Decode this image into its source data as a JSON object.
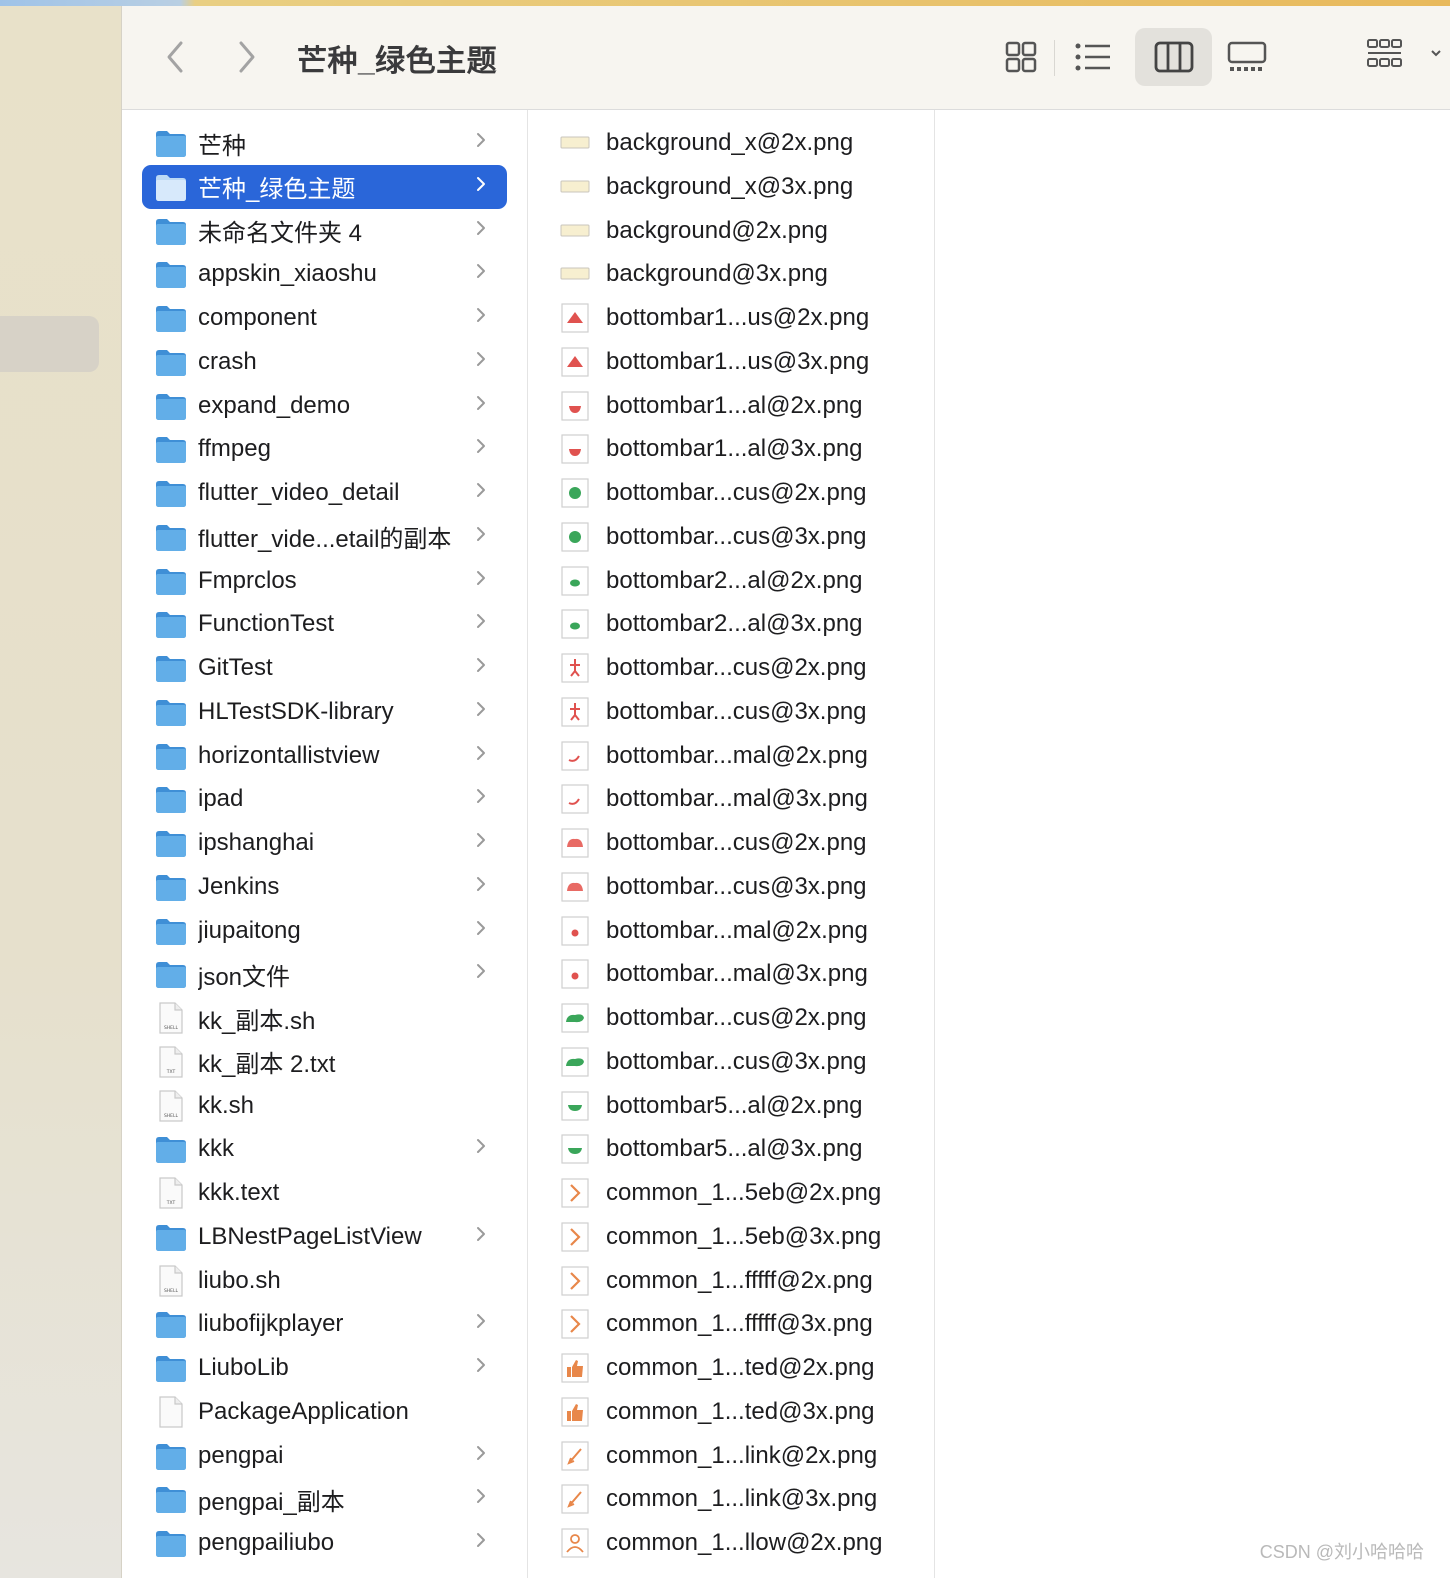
{
  "window": {
    "title": "芒种_绿色主题"
  },
  "toolbar": {
    "back_icon": "chevron-left-icon",
    "forward_icon": "chevron-right-icon",
    "views": [
      "icon-view",
      "list-view",
      "column-view",
      "gallery-view",
      "group-by"
    ]
  },
  "folder_column": [
    {
      "label": "芒种",
      "kind": "folder"
    },
    {
      "label": "芒种_绿色主题",
      "kind": "folder",
      "selected": true
    },
    {
      "label": "未命名文件夹 4",
      "kind": "folder"
    },
    {
      "label": "appskin_xiaoshu",
      "kind": "folder"
    },
    {
      "label": "component",
      "kind": "folder"
    },
    {
      "label": "crash",
      "kind": "folder"
    },
    {
      "label": "expand_demo",
      "kind": "folder"
    },
    {
      "label": "ffmpeg",
      "kind": "folder"
    },
    {
      "label": "flutter_video_detail",
      "kind": "folder"
    },
    {
      "label": "flutter_vide...etail的副本",
      "kind": "folder"
    },
    {
      "label": "Fmprclos",
      "kind": "folder"
    },
    {
      "label": "FunctionTest",
      "kind": "folder"
    },
    {
      "label": "GitTest",
      "kind": "folder"
    },
    {
      "label": "HLTestSDK-library",
      "kind": "folder"
    },
    {
      "label": "horizontallistview",
      "kind": "folder"
    },
    {
      "label": "ipad",
      "kind": "folder"
    },
    {
      "label": "ipshanghai",
      "kind": "folder"
    },
    {
      "label": "Jenkins",
      "kind": "folder"
    },
    {
      "label": "jiupaitong",
      "kind": "folder"
    },
    {
      "label": "json文件",
      "kind": "folder"
    },
    {
      "label": "kk_副本.sh",
      "kind": "shell"
    },
    {
      "label": "kk_副本 2.txt",
      "kind": "txt"
    },
    {
      "label": "kk.sh",
      "kind": "shell"
    },
    {
      "label": "kkk",
      "kind": "folder"
    },
    {
      "label": "kkk.text",
      "kind": "txt"
    },
    {
      "label": "LBNestPageListView",
      "kind": "folder"
    },
    {
      "label": "liubo.sh",
      "kind": "shell"
    },
    {
      "label": "liubofijkplayer",
      "kind": "folder"
    },
    {
      "label": "LiuboLib",
      "kind": "folder"
    },
    {
      "label": "PackageApplication",
      "kind": "doc"
    },
    {
      "label": "pengpai",
      "kind": "folder"
    },
    {
      "label": "pengpai_副本",
      "kind": "folder"
    },
    {
      "label": "pengpailiubo",
      "kind": "folder"
    }
  ],
  "file_types": {
    "shell": "SHELL",
    "txt": "TXT"
  },
  "file_column": [
    {
      "label": "background_x@2x.png",
      "thumb": "bar"
    },
    {
      "label": "background_x@3x.png",
      "thumb": "bar"
    },
    {
      "label": "background@2x.png",
      "thumb": "bar"
    },
    {
      "label": "background@3x.png",
      "thumb": "bar"
    },
    {
      "label": "bottombar1...us@2x.png",
      "thumb": "red-melon"
    },
    {
      "label": "bottombar1...us@3x.png",
      "thumb": "red-melon"
    },
    {
      "label": "bottombar1...al@2x.png",
      "thumb": "red-bowl"
    },
    {
      "label": "bottombar1...al@3x.png",
      "thumb": "red-bowl"
    },
    {
      "label": "bottombar...cus@2x.png",
      "thumb": "green-dot"
    },
    {
      "label": "bottombar...cus@3x.png",
      "thumb": "green-dot"
    },
    {
      "label": "bottombar2...al@2x.png",
      "thumb": "green-leaf"
    },
    {
      "label": "bottombar2...al@3x.png",
      "thumb": "green-leaf"
    },
    {
      "label": "bottombar...cus@2x.png",
      "thumb": "red-figure"
    },
    {
      "label": "bottombar...cus@3x.png",
      "thumb": "red-figure"
    },
    {
      "label": "bottombar...mal@2x.png",
      "thumb": "red-hook"
    },
    {
      "label": "bottombar...mal@3x.png",
      "thumb": "red-hook"
    },
    {
      "label": "bottombar...cus@2x.png",
      "thumb": "red-blob"
    },
    {
      "label": "bottombar...cus@3x.png",
      "thumb": "red-blob"
    },
    {
      "label": "bottombar...mal@2x.png",
      "thumb": "red-small"
    },
    {
      "label": "bottombar...mal@3x.png",
      "thumb": "red-small"
    },
    {
      "label": "bottombar...cus@2x.png",
      "thumb": "green-cloud"
    },
    {
      "label": "bottombar...cus@3x.png",
      "thumb": "green-cloud"
    },
    {
      "label": "bottombar5...al@2x.png",
      "thumb": "green-bowl"
    },
    {
      "label": "bottombar5...al@3x.png",
      "thumb": "green-bowl"
    },
    {
      "label": "common_1...5eb@2x.png",
      "thumb": "orange-chevron"
    },
    {
      "label": "common_1...5eb@3x.png",
      "thumb": "orange-chevron"
    },
    {
      "label": "common_1...fffff@2x.png",
      "thumb": "orange-chevron"
    },
    {
      "label": "common_1...fffff@3x.png",
      "thumb": "orange-chevron"
    },
    {
      "label": "common_1...ted@2x.png",
      "thumb": "orange-thumb"
    },
    {
      "label": "common_1...ted@3x.png",
      "thumb": "orange-thumb"
    },
    {
      "label": "common_1...link@2x.png",
      "thumb": "orange-link"
    },
    {
      "label": "common_1...link@3x.png",
      "thumb": "orange-link"
    },
    {
      "label": "common_1...llow@2x.png",
      "thumb": "orange-person"
    }
  ],
  "watermark": "CSDN @刘小哈哈哈",
  "colors": {
    "selection": "#2a66d9",
    "folder": "#62aee8",
    "folder_dark": "#3f8fd6"
  }
}
